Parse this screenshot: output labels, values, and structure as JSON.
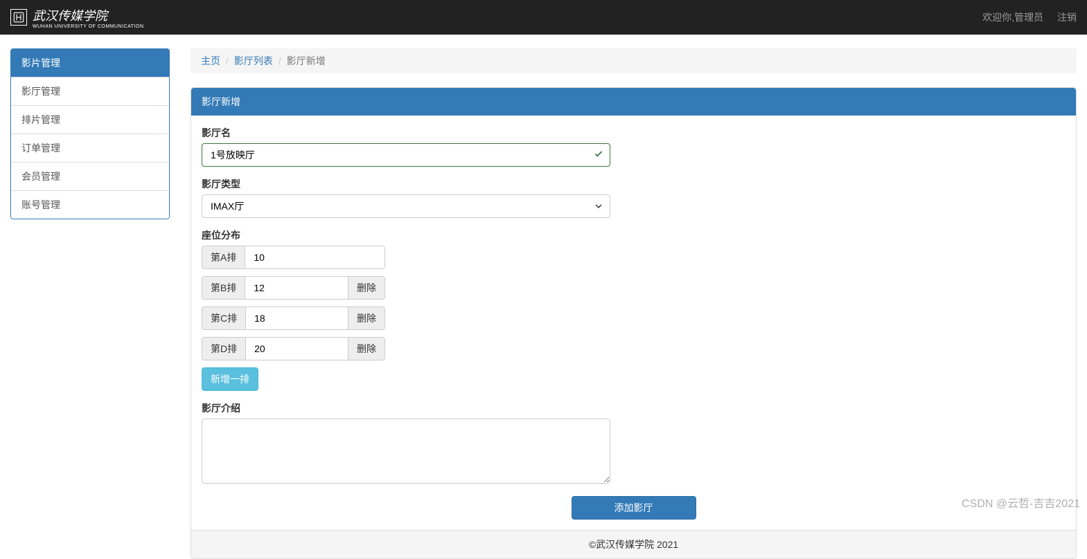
{
  "navbar": {
    "brand_main": "武汉传媒学院",
    "brand_sub": "WUHAN UNIVERSITY OF COMMUNICATION",
    "welcome": "欢迎你,管理员",
    "logout": "注销"
  },
  "sidebar": {
    "heading": "影片管理",
    "items": [
      {
        "label": "影厅管理"
      },
      {
        "label": "排片管理"
      },
      {
        "label": "订单管理"
      },
      {
        "label": "会员管理"
      },
      {
        "label": "账号管理"
      }
    ]
  },
  "breadcrumb": {
    "home": "主页",
    "list": "影厅列表",
    "current": "影厅新增"
  },
  "form": {
    "panel_title": "影厅新增",
    "name_label": "影厅名",
    "name_value": "1号放映厅",
    "type_label": "影厅类型",
    "type_value": "IMAX厅",
    "seat_label": "座位分布",
    "rows": [
      {
        "label": "第A排",
        "value": "10",
        "delete": ""
      },
      {
        "label": "第B排",
        "value": "12",
        "delete": "删除"
      },
      {
        "label": "第C排",
        "value": "18",
        "delete": "删除"
      },
      {
        "label": "第D排",
        "value": "20",
        "delete": "删除"
      }
    ],
    "add_row_label": "新增一排",
    "intro_label": "影厅介绍",
    "intro_value": "",
    "submit_label": "添加影厅"
  },
  "footer": {
    "copyright": "©武汉传媒学院 2021"
  },
  "watermark": "CSDN @云哲-吉吉2021"
}
